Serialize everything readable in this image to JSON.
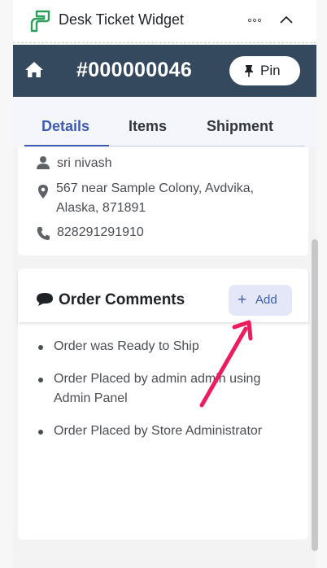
{
  "widget": {
    "title": "Desk Ticket Widget",
    "icons": {
      "logo": "desk-logo-icon",
      "more": "more-horizontal-icon",
      "collapse": "chevron-up-icon"
    },
    "accent": "#2e9e5b"
  },
  "ticket": {
    "number": "#000000046",
    "pin_label": "Pin",
    "bar_color": "#34495e"
  },
  "tabs": [
    {
      "label": "Details",
      "active": true
    },
    {
      "label": "Items",
      "active": false
    },
    {
      "label": "Shipment",
      "active": false
    }
  ],
  "customer": {
    "name": "sri nivash",
    "address": "567 near Sample Colony, Avdvika, Alaska, 871891",
    "phone": "828291291910"
  },
  "comments": {
    "title": "Order Comments",
    "add_label": "Add",
    "items": [
      "Order was Ready to Ship",
      "Order Placed by admin admin using Admin Panel",
      "Order Placed by Store Administrator"
    ]
  },
  "colors": {
    "primary": "#3f5bb5",
    "annotation_arrow": "#ec1c5f"
  }
}
